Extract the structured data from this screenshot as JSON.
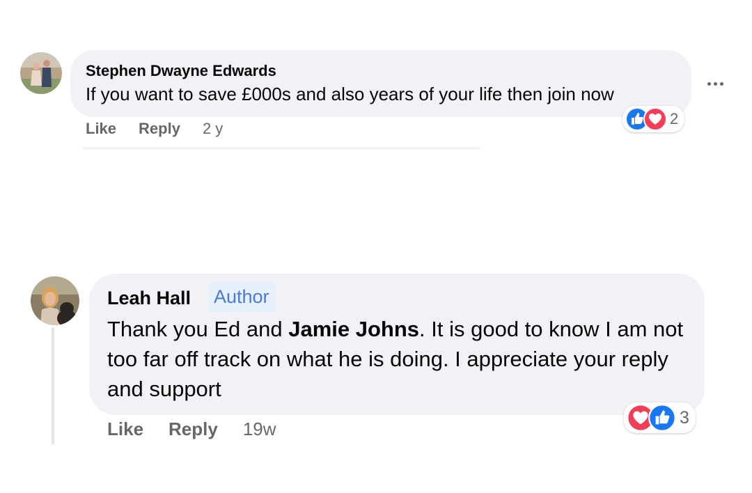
{
  "colors": {
    "bubble_bg": "#f0f2f5",
    "meta_text": "#65676b",
    "author_badge_bg": "#e7f0fd",
    "author_badge_text": "#4a79d9",
    "like_blue": "#1877f2",
    "love_red": "#f33e58"
  },
  "comments": [
    {
      "author": "Stephen Dwayne Edwards",
      "text": "If you want to save £000s and also years of your life then join now",
      "actions": {
        "like": "Like",
        "reply": "Reply",
        "time": "2 y"
      },
      "reactions": {
        "icons": [
          "like-icon",
          "love-icon"
        ],
        "count": "2"
      },
      "menu_icon": "more-options-icon"
    },
    {
      "author": "Leah Hall",
      "badge": "Author",
      "text_prefix": "Thank you Ed and ",
      "mention": "Jamie Johns",
      "text_suffix": ". It is good to know I am not too far off track on what he is doing. I appreciate your reply and support",
      "actions": {
        "like": "Like",
        "reply": "Reply",
        "time": "19w"
      },
      "reactions": {
        "icons": [
          "love-icon",
          "like-icon"
        ],
        "count": "3"
      }
    }
  ]
}
